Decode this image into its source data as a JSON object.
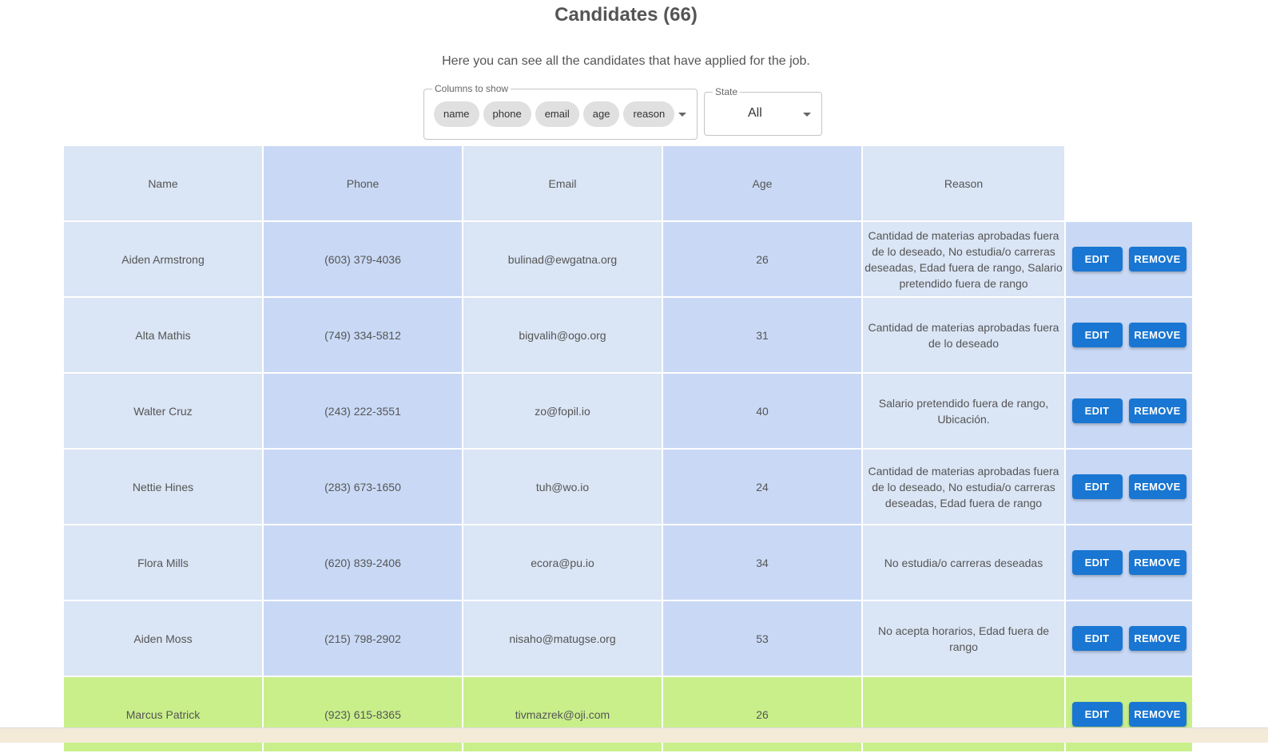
{
  "page": {
    "title": "Candidates (66)",
    "subtitle": "Here you can see all the candidates that have applied for the job."
  },
  "filters": {
    "columns_label": "Columns to show",
    "columns_chips": [
      "name",
      "phone",
      "email",
      "age",
      "reason"
    ],
    "state_label": "State",
    "state_value": "All"
  },
  "table": {
    "headers": {
      "name": "Name",
      "phone": "Phone",
      "email": "Email",
      "age": "Age",
      "reason": "Reason"
    },
    "edit_label": "EDIT",
    "remove_label": "REMOVE",
    "rows": [
      {
        "name": "Aiden Armstrong",
        "phone": "(603) 379-4036",
        "email": "bulinad@ewgatna.org",
        "age": "26",
        "reason": "Cantidad de materias aprobadas fuera de lo deseado, No estudia/o carreras deseadas, Edad fuera de rango, Salario pretendido fuera de rango"
      },
      {
        "name": "Alta Mathis",
        "phone": "(749) 334-5812",
        "email": "bigvalih@ogo.org",
        "age": "31",
        "reason": "Cantidad de materias aprobadas fuera de lo deseado"
      },
      {
        "name": "Walter Cruz",
        "phone": "(243) 222-3551",
        "email": "zo@fopil.io",
        "age": "40",
        "reason": "Salario pretendido fuera de rango, Ubicación."
      },
      {
        "name": "Nettie Hines",
        "phone": "(283) 673-1650",
        "email": "tuh@wo.io",
        "age": "24",
        "reason": "Cantidad de materias aprobadas fuera de lo deseado, No estudia/o carreras deseadas, Edad fuera de rango"
      },
      {
        "name": "Flora Mills",
        "phone": "(620) 839-2406",
        "email": "ecora@pu.io",
        "age": "34",
        "reason": "No estudia/o carreras deseadas"
      },
      {
        "name": "Aiden Moss",
        "phone": "(215) 798-2902",
        "email": "nisaho@matugse.org",
        "age": "53",
        "reason": "No acepta horarios, Edad fuera de rango"
      },
      {
        "name": "Marcus Patrick",
        "phone": "(923) 615-8365",
        "email": "tivmazrek@oji.com",
        "age": "26",
        "reason": "",
        "highlighted": true
      }
    ]
  },
  "colors": {
    "button": "#1976d2",
    "cell_light": "#dae5f5",
    "cell_dark": "#c9d9f5",
    "row_highlight": "#c9ef8b"
  }
}
